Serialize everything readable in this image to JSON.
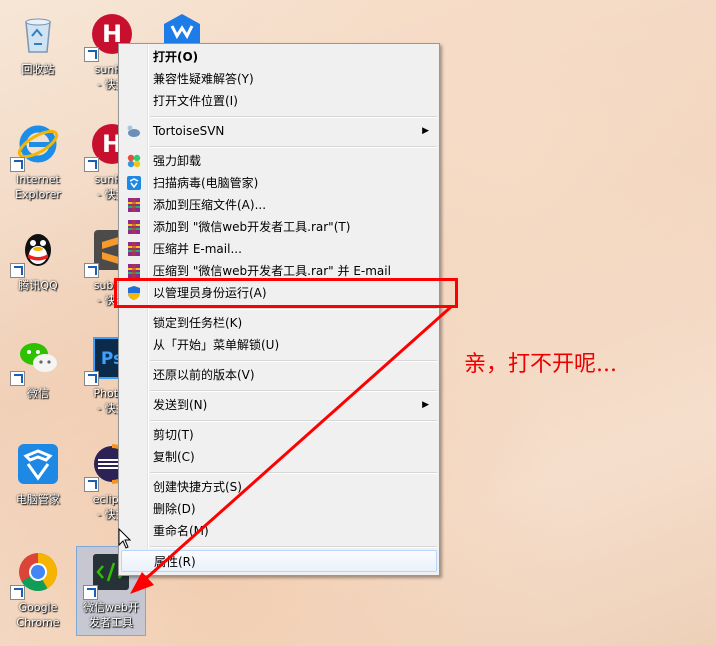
{
  "desktop_icons": [
    {
      "label": "回收站",
      "icon": "recycle-bin-icon"
    },
    {
      "label": "Internet\nExplorer",
      "icon": "ie-icon"
    },
    {
      "label": "腾讯QQ",
      "icon": "qq-icon"
    },
    {
      "label": "微信",
      "icon": "wechat-icon"
    },
    {
      "label": "电脑管家",
      "icon": "pc-manager-icon"
    },
    {
      "label": "Google\nChrome",
      "icon": "chrome-icon"
    },
    {
      "label": "sunHe\n- 快捷",
      "icon": "sunhe-icon"
    },
    {
      "label": "sunHe\n- 快捷",
      "icon": "sunhe-icon"
    },
    {
      "label": "sublim\n- 快捷",
      "icon": "sublime-icon"
    },
    {
      "label": "Photos\n- 快捷",
      "icon": "photoshop-icon"
    },
    {
      "label": "eclipse\n- 快捷",
      "icon": "eclipse-icon"
    },
    {
      "label": "微信web开\n发者工具",
      "icon": "wechat-devtools-icon"
    }
  ],
  "context_menu": {
    "items": [
      {
        "label": "打开(O)"
      },
      {
        "label": "兼容性疑难解答(Y)"
      },
      {
        "label": "打开文件位置(I)"
      },
      {
        "label": "TortoiseSVN"
      },
      {
        "label": "强力卸载"
      },
      {
        "label": "扫描病毒(电脑管家)"
      },
      {
        "label": "添加到压缩文件(A)..."
      },
      {
        "label": "添加到 \"微信web开发者工具.rar\"(T)"
      },
      {
        "label": "压缩并 E-mail..."
      },
      {
        "label": "压缩到 \"微信web开发者工具.rar\" 并 E-mail"
      },
      {
        "label": "以管理员身份运行(A)"
      },
      {
        "label": "锁定到任务栏(K)"
      },
      {
        "label": "从「开始」菜单解锁(U)"
      },
      {
        "label": "还原以前的版本(V)"
      },
      {
        "label": "发送到(N)"
      },
      {
        "label": "剪切(T)"
      },
      {
        "label": "复制(C)"
      },
      {
        "label": "创建快捷方式(S)"
      },
      {
        "label": "删除(D)"
      },
      {
        "label": "重命名(M)"
      },
      {
        "label": "属性(R)"
      }
    ]
  },
  "annotation": {
    "text": "亲，打不开呢..."
  },
  "colors": {
    "annotation": "#ff0000",
    "menu_bg": "#f0f0f0",
    "hover_border": "#b8d6fb"
  }
}
